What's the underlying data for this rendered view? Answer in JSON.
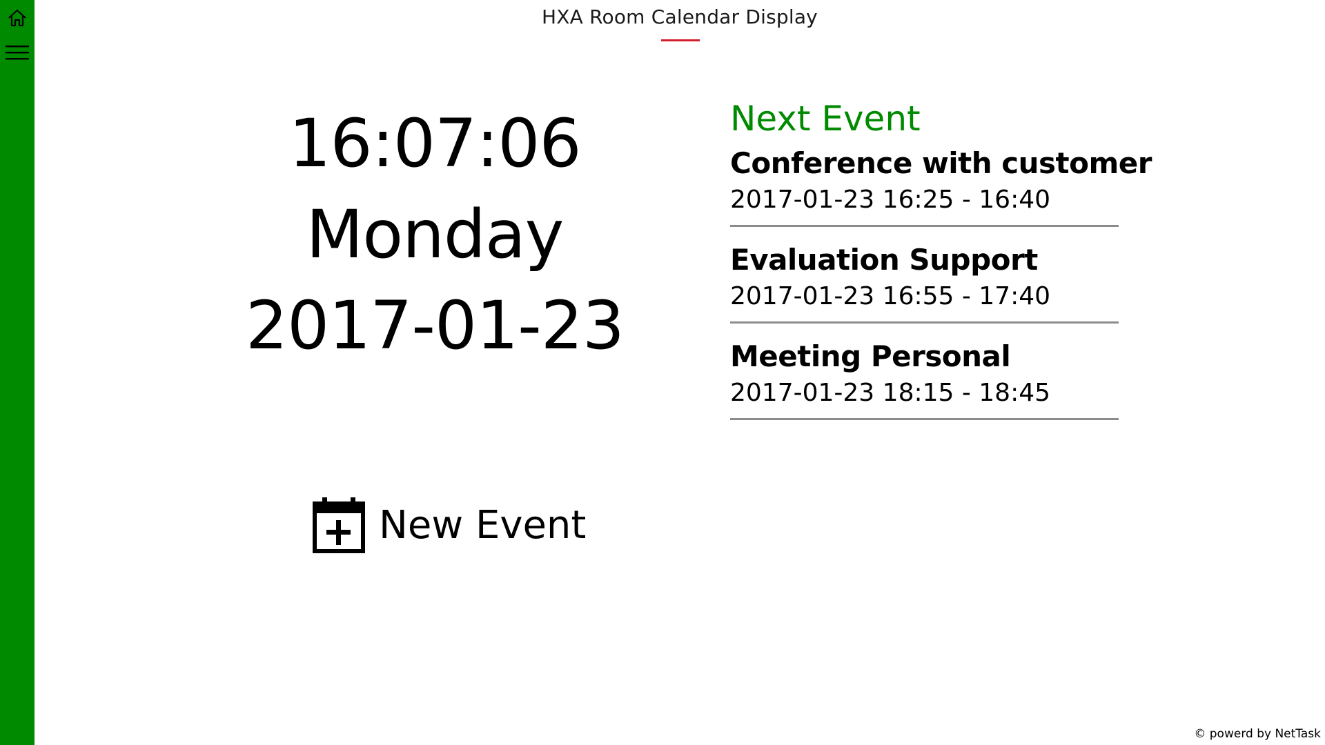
{
  "app": {
    "title": "HXA Room Calendar Display",
    "accent_color": "#008a00",
    "title_underline_color": "#d01f2a"
  },
  "sidebar": {
    "home_icon": "home-icon",
    "menu_icon": "hamburger-menu-icon"
  },
  "clock": {
    "time": "16:07:06",
    "weekday": "Monday",
    "date": "2017-01-23"
  },
  "new_event": {
    "icon": "calendar-add-icon",
    "label": "New Event"
  },
  "events": {
    "heading": "Next Event",
    "items": [
      {
        "title": "Conference with customer",
        "time": "2017-01-23 16:25 - 16:40"
      },
      {
        "title": "Evaluation Support",
        "time": "2017-01-23 16:55 - 17:40"
      },
      {
        "title": "Meeting Personal",
        "time": "2017-01-23 18:15 - 18:45"
      }
    ]
  },
  "footer": {
    "text": "© powerd by NetTask"
  }
}
